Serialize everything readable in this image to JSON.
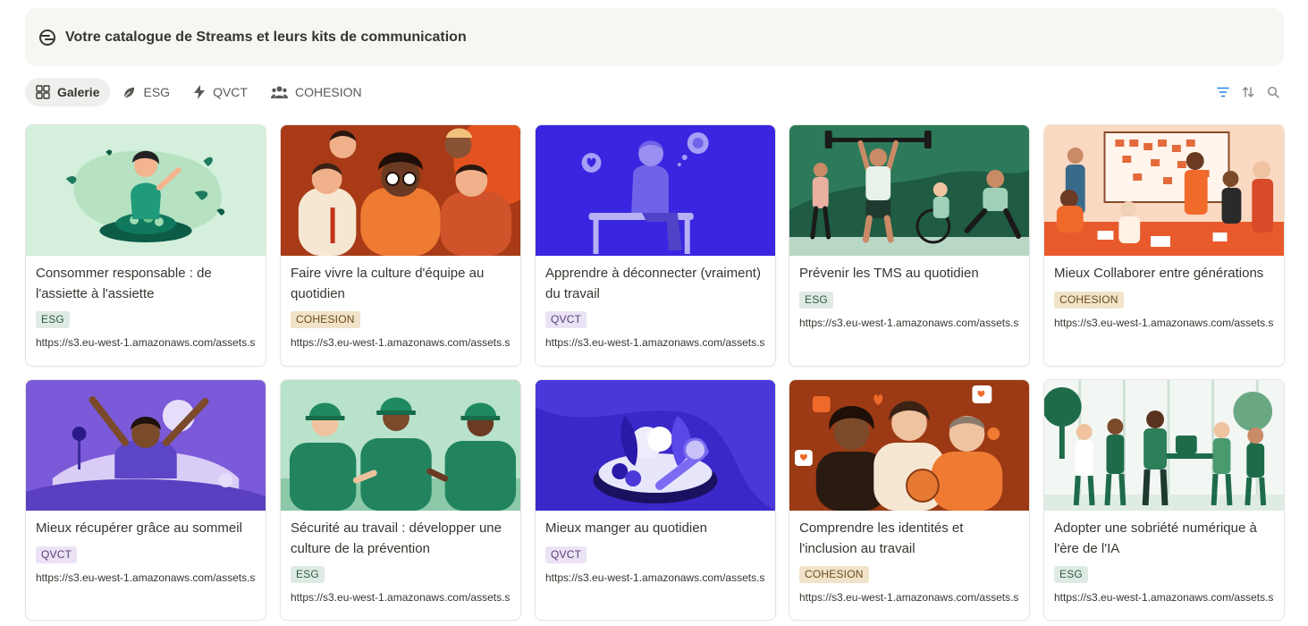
{
  "header": {
    "title": "Votre catalogue de Streams et leurs kits de communication",
    "icon": "streams-logo-icon"
  },
  "tabs": [
    {
      "label": "Galerie",
      "icon": "gallery-grid-icon",
      "active": true
    },
    {
      "label": "ESG",
      "icon": "leaf-icon",
      "active": false
    },
    {
      "label": "QVCT",
      "icon": "lightning-icon",
      "active": false
    },
    {
      "label": "COHESION",
      "icon": "people-icon",
      "active": false
    }
  ],
  "toolbar": {
    "filter_icon": "filter-icon",
    "sort_icon": "sort-icon",
    "search_icon": "search-icon",
    "accent_color": "#2383e2"
  },
  "cards": [
    {
      "title": "Consommer responsable : de l'assiette à l'assiette",
      "tag": "ESG",
      "url": "https://s3.eu-west-1.amazonaws.com/assets.streams",
      "image": "woman-eating-salad-illustration"
    },
    {
      "title": "Faire vivre la culture d'équipe au quotidien",
      "tag": "COHESION",
      "url": "https://s3.eu-west-1.amazonaws.com/assets.streams",
      "image": "team-group-illustration"
    },
    {
      "title": "Apprendre à déconnecter (vraiment) du travail",
      "tag": "QVCT",
      "url": "https://s3.eu-west-1.amazonaws.com/assets.streams",
      "image": "man-on-bench-illustration"
    },
    {
      "title": "Prévenir les TMS au quotidien",
      "tag": "ESG",
      "url": "https://s3.eu-west-1.amazonaws.com/assets.streams",
      "image": "exercise-group-illustration"
    },
    {
      "title": "Mieux Collaborer entre générations",
      "tag": "COHESION",
      "url": "https://s3.eu-west-1.amazonaws.com/assets.streams",
      "image": "meeting-board-illustration"
    },
    {
      "title": "Mieux récupérer grâce au sommeil",
      "tag": "QVCT",
      "url": "https://s3.eu-west-1.amazonaws.com/assets.streams",
      "image": "waking-up-illustration"
    },
    {
      "title": "Sécurité au travail : développer une culture de la prévention",
      "tag": "ESG",
      "url": "https://s3.eu-west-1.amazonaws.com/assets.streams",
      "image": "hardhat-workers-illustration"
    },
    {
      "title": "Mieux manger au quotidien",
      "tag": "QVCT",
      "url": "https://s3.eu-west-1.amazonaws.com/assets.streams",
      "image": "vegetable-plate-illustration"
    },
    {
      "title": "Comprendre les identités et l'inclusion au travail",
      "tag": "COHESION",
      "url": "https://s3.eu-west-1.amazonaws.com/assets.streams",
      "image": "inclusion-group-illustration"
    },
    {
      "title": "Adopter une sobriété numérique à l'ère de l'IA",
      "tag": "ESG",
      "url": "https://s3.eu-west-1.amazonaws.com/assets.streams",
      "image": "green-office-illustration"
    }
  ]
}
